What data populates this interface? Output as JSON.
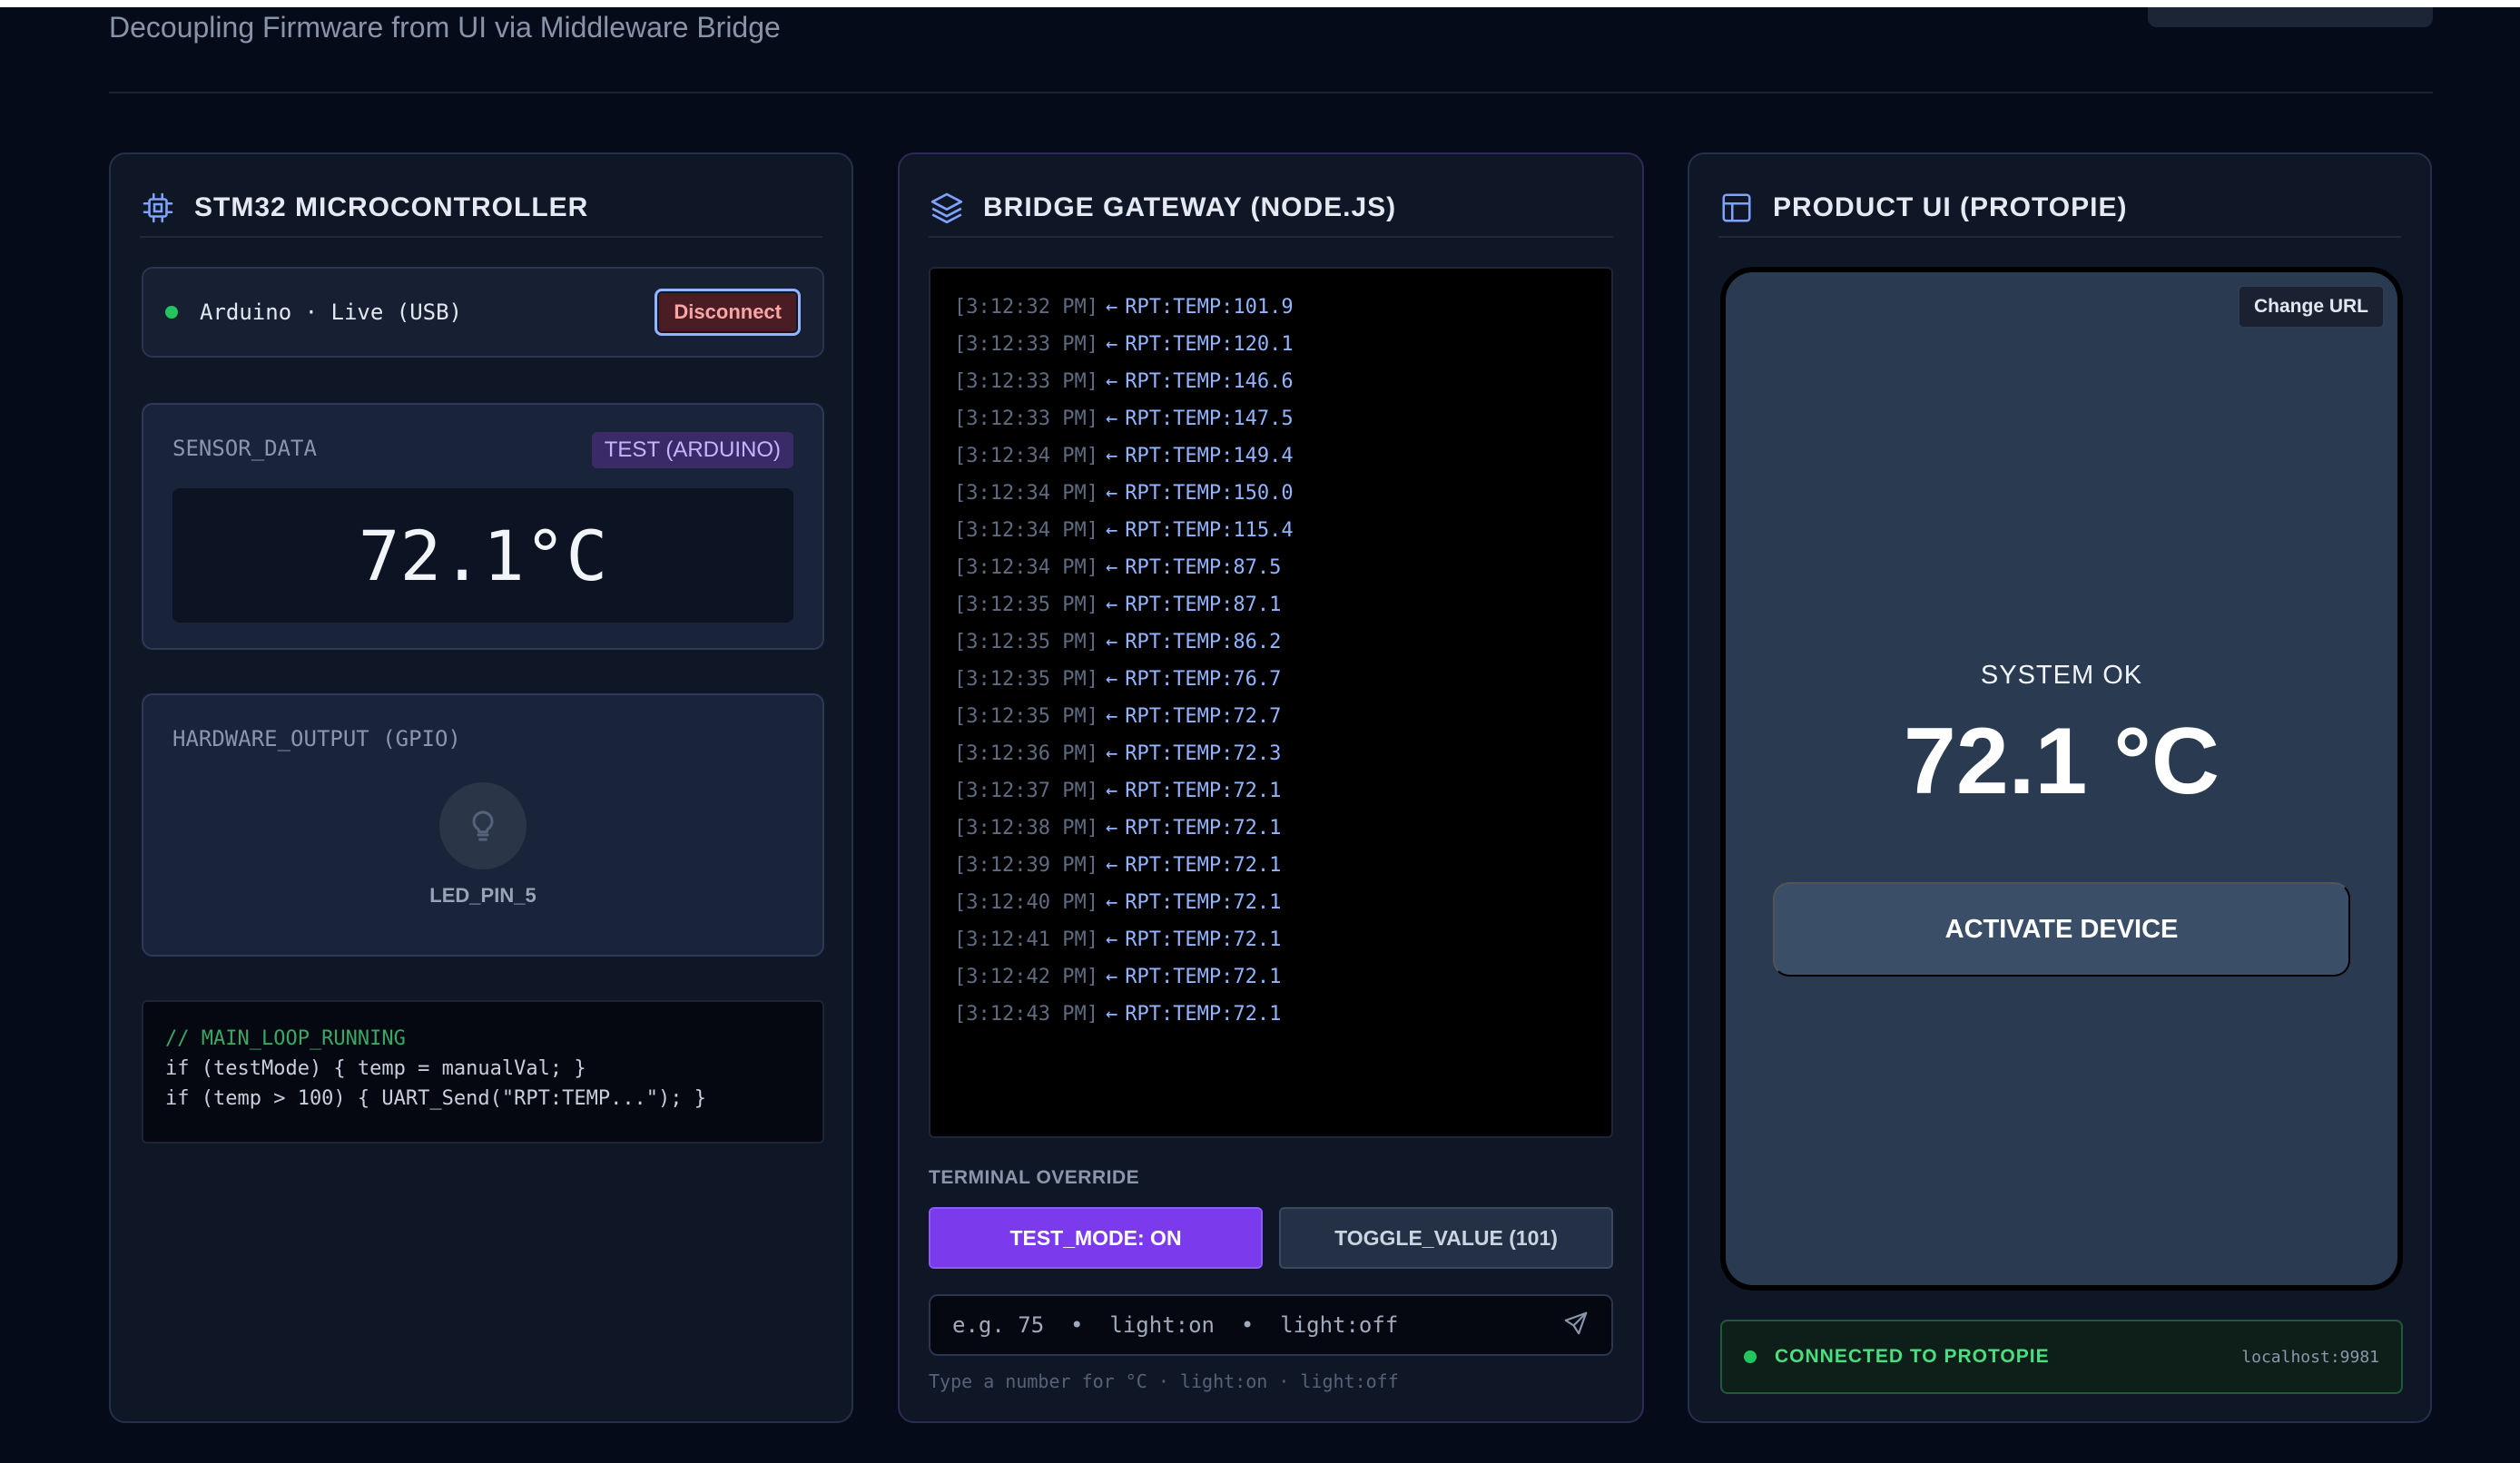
{
  "header": {
    "subtitle": "Decoupling Firmware from UI via Middleware Bridge"
  },
  "mcu": {
    "title": "STM32 MICROCONTROLLER",
    "connection_text": "Arduino · Live (USB)",
    "disconnect_label": "Disconnect",
    "sensor_label": "SENSOR_DATA",
    "sensor_badge": "TEST (ARDUINO)",
    "sensor_value": "72.1°C",
    "gpio_label": "HARDWARE_OUTPUT (GPIO)",
    "led_label": "LED_PIN_5",
    "led_on": false,
    "code": {
      "comment": "// MAIN_LOOP_RUNNING",
      "line1": "if (testMode) { temp = manualVal; }",
      "line2": "if (temp > 100) { UART_Send(\"RPT:TEMP...\"); }"
    }
  },
  "bridge": {
    "title": "BRIDGE GATEWAY (NODE.JS)",
    "log": [
      {
        "ts": "[3:12:32 PM]",
        "arrow": "←",
        "msg": "RPT:TEMP:101.9"
      },
      {
        "ts": "[3:12:33 PM]",
        "arrow": "←",
        "msg": "RPT:TEMP:120.1"
      },
      {
        "ts": "[3:12:33 PM]",
        "arrow": "←",
        "msg": "RPT:TEMP:146.6"
      },
      {
        "ts": "[3:12:33 PM]",
        "arrow": "←",
        "msg": "RPT:TEMP:147.5"
      },
      {
        "ts": "[3:12:34 PM]",
        "arrow": "←",
        "msg": "RPT:TEMP:149.4"
      },
      {
        "ts": "[3:12:34 PM]",
        "arrow": "←",
        "msg": "RPT:TEMP:150.0"
      },
      {
        "ts": "[3:12:34 PM]",
        "arrow": "←",
        "msg": "RPT:TEMP:115.4"
      },
      {
        "ts": "[3:12:34 PM]",
        "arrow": "←",
        "msg": "RPT:TEMP:87.5"
      },
      {
        "ts": "[3:12:35 PM]",
        "arrow": "←",
        "msg": "RPT:TEMP:87.1"
      },
      {
        "ts": "[3:12:35 PM]",
        "arrow": "←",
        "msg": "RPT:TEMP:86.2"
      },
      {
        "ts": "[3:12:35 PM]",
        "arrow": "←",
        "msg": "RPT:TEMP:76.7"
      },
      {
        "ts": "[3:12:35 PM]",
        "arrow": "←",
        "msg": "RPT:TEMP:72.7"
      },
      {
        "ts": "[3:12:36 PM]",
        "arrow": "←",
        "msg": "RPT:TEMP:72.3"
      },
      {
        "ts": "[3:12:37 PM]",
        "arrow": "←",
        "msg": "RPT:TEMP:72.1"
      },
      {
        "ts": "[3:12:38 PM]",
        "arrow": "←",
        "msg": "RPT:TEMP:72.1"
      },
      {
        "ts": "[3:12:39 PM]",
        "arrow": "←",
        "msg": "RPT:TEMP:72.1"
      },
      {
        "ts": "[3:12:40 PM]",
        "arrow": "←",
        "msg": "RPT:TEMP:72.1"
      },
      {
        "ts": "[3:12:41 PM]",
        "arrow": "←",
        "msg": "RPT:TEMP:72.1"
      },
      {
        "ts": "[3:12:42 PM]",
        "arrow": "←",
        "msg": "RPT:TEMP:72.1"
      },
      {
        "ts": "[3:12:43 PM]",
        "arrow": "←",
        "msg": "RPT:TEMP:72.1"
      }
    ],
    "override_label": "TERMINAL OVERRIDE",
    "test_mode_label": "TEST_MODE: ON",
    "toggle_value_label": "TOGGLE_VALUE (101)",
    "command_placeholder": "e.g. 75  •  light:on  •  light:off",
    "hint": "Type a number for °C · light:on · light:off"
  },
  "proto": {
    "title": "PRODUCT UI (PROTOPIE)",
    "change_url_label": "Change URL",
    "system_status": "SYSTEM OK",
    "temperature": "72.1 °C",
    "activate_label": "ACTIVATE DEVICE",
    "connection_status": "CONNECTED TO PROTOPIE",
    "host": "localhost:9981"
  },
  "colors": {
    "background": "#060b1a",
    "panel": "#0f1727",
    "accent_purple": "#7c3aed",
    "status_green": "#22c55e",
    "log_blue": "#93b4ff",
    "danger": "#fca5a5"
  }
}
